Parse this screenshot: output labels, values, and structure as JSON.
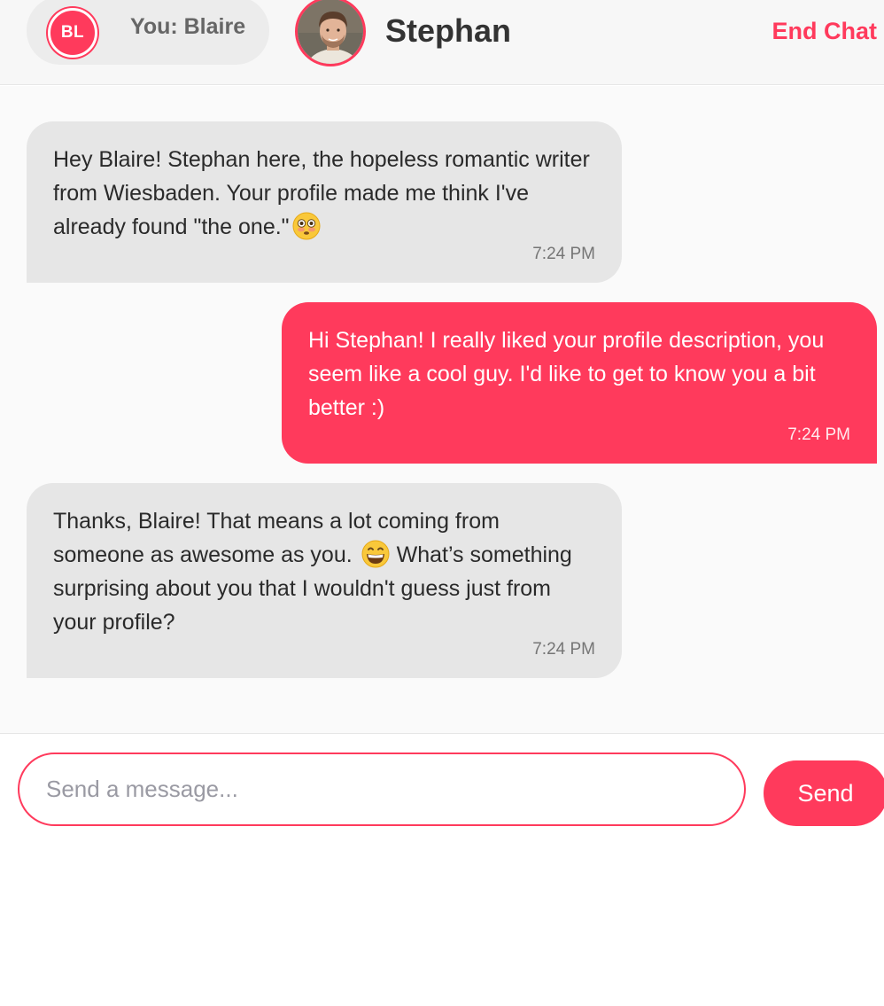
{
  "header": {
    "user_initials": "BL",
    "user_label": "You: Blaire",
    "contact_name": "Stephan",
    "contact_avatar_icon": "profile-photo",
    "end_chat_label": "End Chat"
  },
  "messages": [
    {
      "direction": "received",
      "text": "Hey Blaire! Stephan here, the hopeless romantic writer from Wiesbaden. Your profile made me think I've already found \"the one.\"",
      "emoji_after": "flushed-face-emoji",
      "time": "7:24 PM"
    },
    {
      "direction": "sent",
      "text": "Hi Stephan! I really liked your profile description, you seem like a cool guy. I'd like to get to know you a bit better :)",
      "time": "7:24 PM"
    },
    {
      "direction": "received",
      "text_before_emoji": "Thanks, Blaire! That means a lot coming from someone as awesome as you.",
      "emoji": "grinning-face-emoji",
      "text_after_emoji": "What’s something surprising about you that I wouldn't guess just from your profile?",
      "time": "7:24 PM"
    }
  ],
  "composer": {
    "placeholder": "Send a message...",
    "value": "",
    "send_label": "Send"
  },
  "colors": {
    "accent": "#ff3a5c",
    "received_bubble": "#e6e6e6",
    "background": "#fafafa"
  }
}
